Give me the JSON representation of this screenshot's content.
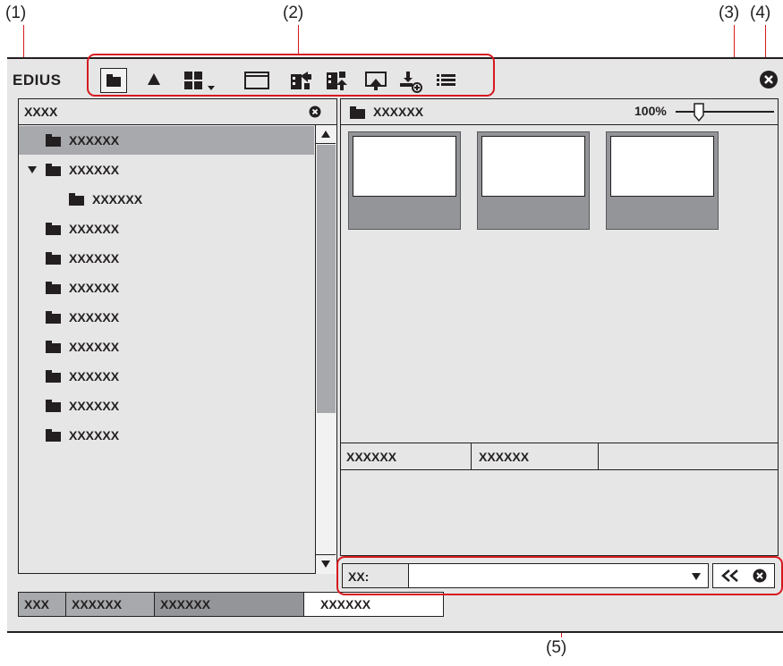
{
  "callouts": [
    "(1)",
    "(2)",
    "(3)",
    "(4)",
    "(5)"
  ],
  "window": {
    "app_title": "EDIUS",
    "toolbar_icons": [
      "folder-view-icon",
      "up-folder-icon",
      "view-mode-icon",
      "window-icon",
      "import-icon",
      "export-icon",
      "output-icon",
      "add-clip-icon",
      "list-icon"
    ],
    "colors": {
      "callout_red": "#d71920",
      "panel_bg": "#e6e6e6",
      "thumb_gray": "#939598",
      "selected_row": "#a7a9ac"
    }
  },
  "folder_panel": {
    "title": "XXXX",
    "items": [
      {
        "label": "XXXXXX",
        "selected": true,
        "expanded": false,
        "indent": 0
      },
      {
        "label": "XXXXXX",
        "selected": false,
        "expanded": true,
        "indent": 0
      },
      {
        "label": "XXXXXX",
        "selected": false,
        "expanded": false,
        "indent": 1
      },
      {
        "label": "XXXXXX",
        "selected": false,
        "expanded": false,
        "indent": 0
      },
      {
        "label": "XXXXXX",
        "selected": false,
        "expanded": false,
        "indent": 0
      },
      {
        "label": "XXXXXX",
        "selected": false,
        "expanded": false,
        "indent": 0
      },
      {
        "label": "XXXXXX",
        "selected": false,
        "expanded": false,
        "indent": 0
      },
      {
        "label": "XXXXXX",
        "selected": false,
        "expanded": false,
        "indent": 0
      },
      {
        "label": "XXXXXX",
        "selected": false,
        "expanded": false,
        "indent": 0
      },
      {
        "label": "XXXXXX",
        "selected": false,
        "expanded": false,
        "indent": 0
      },
      {
        "label": "XXXXXX",
        "selected": false,
        "expanded": false,
        "indent": 0
      }
    ]
  },
  "clip_view": {
    "path_label": "XXXXXX",
    "zoom": "100%",
    "zoom_fraction": 0.2,
    "thumbnail_count": 3
  },
  "properties": {
    "columns": [
      "XXXXXX",
      "XXXXXX",
      ""
    ]
  },
  "search_bar": {
    "label": "XX:",
    "value": ""
  },
  "bottom_tabs": [
    "XXX",
    "XXXXXX",
    "XXXXXX",
    "XXXXXX"
  ]
}
